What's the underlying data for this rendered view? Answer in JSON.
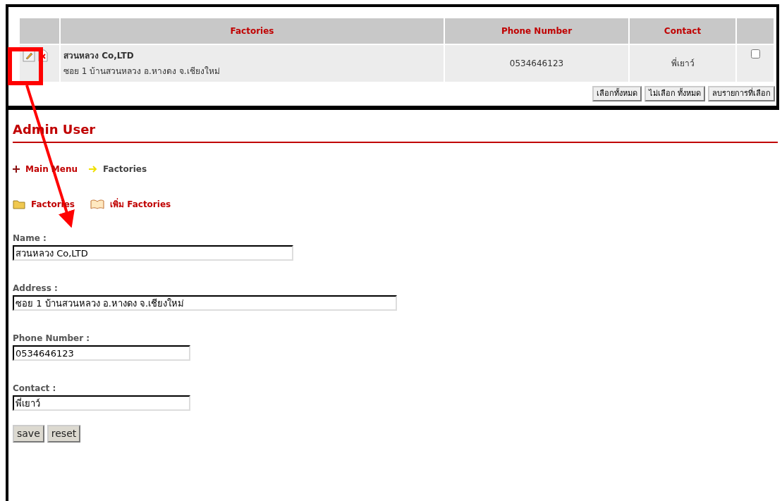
{
  "table": {
    "columns": [
      "Factories",
      "Phone Number",
      "Contact"
    ],
    "rows": [
      {
        "name": "สวนหลวง Co,LTD",
        "address": "ซอย 1 บ้านสวนหลวง อ.หางดง จ.เชียงใหม่",
        "phone": "0534646123",
        "contact": "พี่เยาว์",
        "checked": false
      }
    ]
  },
  "table_buttons": [
    "เลือกทั้งหมด",
    "ไม่เลือก ทั้งหมด",
    "ลบรายการที่เลือก"
  ],
  "page_title": "Admin User",
  "breadcrumb": [
    "Main Menu",
    "Factories"
  ],
  "links": [
    "Factories",
    "เพิ่ม Factories"
  ],
  "form": {
    "fields": [
      {
        "label": "Name :",
        "value": "สวนหลวง Co,LTD"
      },
      {
        "label": "Address :",
        "value": "ซอย 1 บ้านสวนหลวง อ.หางดง จ.เชียงใหม่"
      },
      {
        "label": "Phone Number :",
        "value": "0534646123"
      },
      {
        "label": "Contact :",
        "value": "พี่เยาว์"
      }
    ],
    "buttons": [
      "save",
      "reset"
    ]
  }
}
